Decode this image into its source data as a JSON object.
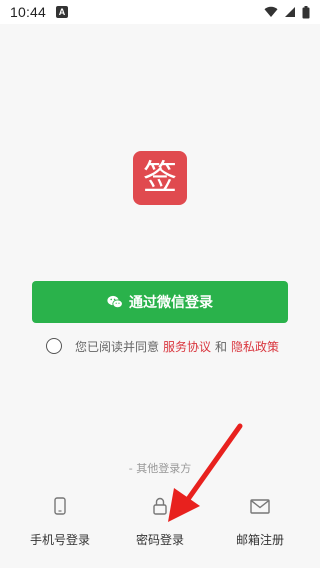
{
  "status_bar": {
    "time": "10:44",
    "notification_icon": "A",
    "icons": [
      "wifi-icon",
      "signal-icon",
      "battery-icon"
    ]
  },
  "app": {
    "logo_text": "签",
    "logo_color": "#e04a4f"
  },
  "wechat_login": {
    "label": "通过微信登录",
    "color": "#2ab24b",
    "icon": "wechat-icon"
  },
  "agreement": {
    "prefix": "您已阅读并同意",
    "service_link": "服务协议",
    "and": "和",
    "privacy_link": "隐私政策",
    "link_color": "#d9363e"
  },
  "other_login": {
    "label": "- 其他登录方"
  },
  "bottom_options": [
    {
      "label": "手机号登录",
      "icon": "phone-icon"
    },
    {
      "label": "密码登录",
      "icon": "lock-icon"
    },
    {
      "label": "邮箱注册",
      "icon": "mail-icon"
    }
  ],
  "annotation": {
    "arrow_color": "#e8211e"
  }
}
